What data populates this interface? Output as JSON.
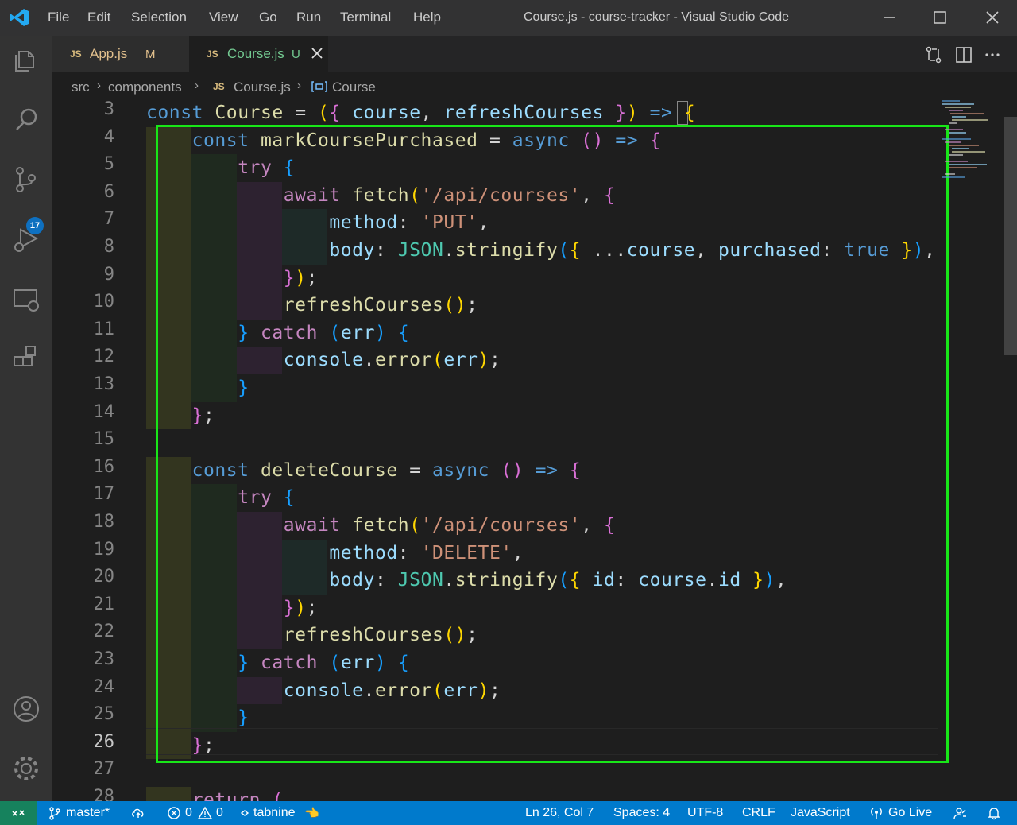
{
  "titlebar": {
    "menu": [
      "File",
      "Edit",
      "Selection",
      "View",
      "Go",
      "Run",
      "Terminal",
      "Help"
    ],
    "title": "Course.js - course-tracker - Visual Studio Code",
    "controls": [
      "minimize-icon",
      "maximize-icon",
      "close-icon"
    ]
  },
  "activitybar": {
    "items": [
      "explorer-icon",
      "search-icon",
      "source-control-icon",
      "run-debug-icon",
      "remote-explorer-icon",
      "extensions-icon"
    ],
    "scm_badge": "17",
    "bottom": [
      "accounts-icon",
      "settings-gear-icon"
    ]
  },
  "tabs": [
    {
      "badge": "JS",
      "name": "App.js",
      "status": "M",
      "status_color": "#e2c08d"
    },
    {
      "badge": "JS",
      "name": "Course.js",
      "status": "U",
      "status_color": "#73c991"
    }
  ],
  "breadcrumb": {
    "items": [
      "src",
      "components",
      "Course.js",
      "Course"
    ],
    "file_badge": "JS"
  },
  "editor": {
    "line_numbers": [
      "3",
      "4",
      "5",
      "6",
      "7",
      "8",
      "9",
      "10",
      "11",
      "12",
      "13",
      "14",
      "15",
      "16",
      "17",
      "18",
      "19",
      "20",
      "21",
      "22",
      "23",
      "24",
      "25",
      "26",
      "27",
      "28"
    ],
    "active_line": "26"
  },
  "statusbar": {
    "branch": "master*",
    "errors": "0",
    "warnings": "0",
    "tabnine": "tabnine",
    "position": "Ln 26, Col 7",
    "spaces": "Spaces: 4",
    "encoding": "UTF-8",
    "eol": "CRLF",
    "language": "JavaScript",
    "golive": "Go Live"
  },
  "colors": {
    "statusbar": "#007acc",
    "highlight_box": "#18e618",
    "activitybar": "#333333"
  }
}
